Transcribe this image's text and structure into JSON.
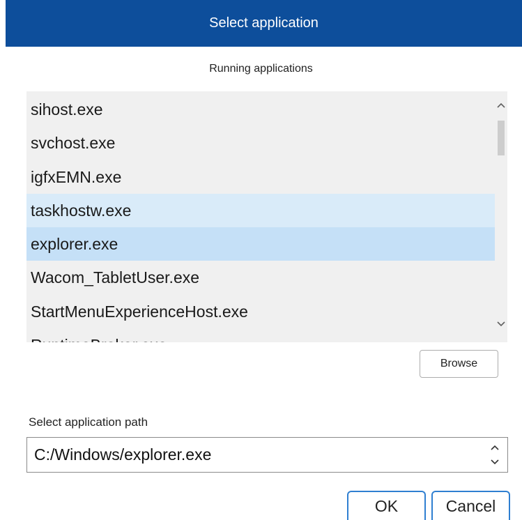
{
  "dialog": {
    "title": "Select application",
    "running_label": "Running applications",
    "browse_label": "Browse",
    "path_label": "Select application path",
    "path_value": "C:/Windows/explorer.exe",
    "ok_label": "OK",
    "cancel_label": "Cancel"
  },
  "applications": [
    {
      "name": "sihost.exe",
      "state": "normal"
    },
    {
      "name": "svchost.exe",
      "state": "normal"
    },
    {
      "name": "igfxEMN.exe",
      "state": "normal"
    },
    {
      "name": "taskhostw.exe",
      "state": "hover"
    },
    {
      "name": "explorer.exe",
      "state": "selected"
    },
    {
      "name": "Wacom_TabletUser.exe",
      "state": "normal"
    },
    {
      "name": "StartMenuExperienceHost.exe",
      "state": "normal"
    },
    {
      "name": "RuntimeBroker.exe",
      "state": "normal"
    }
  ],
  "colors": {
    "titlebar": "#0d4e9b",
    "list_background": "#f0f0f0",
    "hover": "#d9ebf9",
    "selected": "#c5e0f7",
    "focus_border": "#2f7fd1"
  },
  "icons": {
    "scroll_up": "chevron-up-icon",
    "scroll_down": "chevron-down-icon",
    "spin_up": "chevron-up-icon",
    "spin_down": "chevron-down-icon"
  }
}
